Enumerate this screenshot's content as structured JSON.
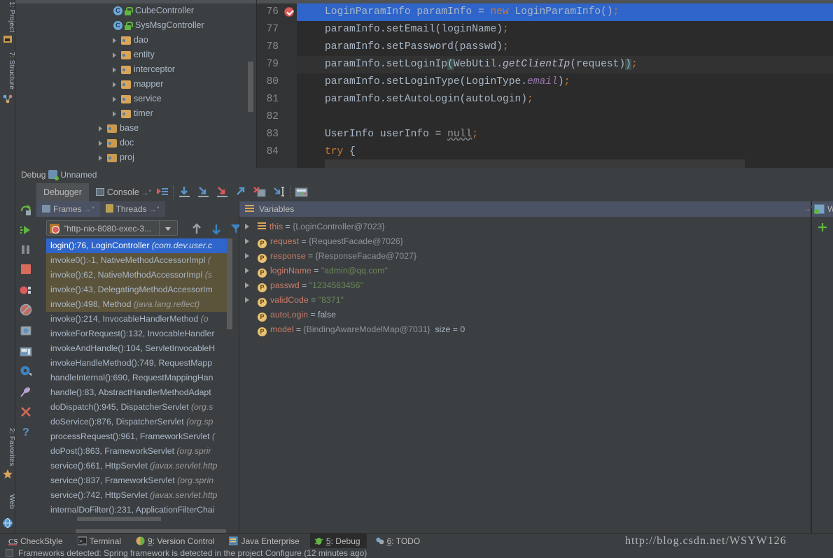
{
  "rail": {
    "tabs": [
      {
        "label": "1: Project",
        "icon": "project-icon",
        "selected": false
      },
      {
        "label": "7: Structure",
        "icon": "structure-icon",
        "selected": false
      },
      {
        "label": "2: Favorites",
        "icon": "star-icon",
        "selected": false
      },
      {
        "label": "Web",
        "icon": "web-icon",
        "selected": false
      }
    ]
  },
  "project_tree": {
    "rows": [
      {
        "label": "CubeController",
        "icon": "java-class-icon",
        "indent": 140,
        "arrow": false,
        "type": "class"
      },
      {
        "label": "SysMsgController",
        "icon": "java-class-icon",
        "indent": 140,
        "arrow": false,
        "type": "class"
      },
      {
        "label": "dao",
        "icon": "folder-icon",
        "indent": 118,
        "arrow": true,
        "type": "folder"
      },
      {
        "label": "entity",
        "icon": "folder-icon",
        "indent": 118,
        "arrow": true,
        "type": "folder"
      },
      {
        "label": "interceptor",
        "icon": "folder-icon",
        "indent": 118,
        "arrow": true,
        "type": "folder"
      },
      {
        "label": "mapper",
        "icon": "folder-icon",
        "indent": 118,
        "arrow": true,
        "type": "folder"
      },
      {
        "label": "service",
        "icon": "folder-icon",
        "indent": 118,
        "arrow": true,
        "type": "folder"
      },
      {
        "label": "timer",
        "icon": "folder-icon",
        "indent": 118,
        "arrow": true,
        "type": "folder"
      },
      {
        "label": "base",
        "icon": "folder-icon",
        "indent": 98,
        "arrow": true,
        "type": "folder"
      },
      {
        "label": "doc",
        "icon": "folder-icon",
        "indent": 98,
        "arrow": true,
        "type": "folder"
      },
      {
        "label": "proj",
        "icon": "folder-icon",
        "indent": 98,
        "arrow": true,
        "type": "folder"
      }
    ]
  },
  "editor": {
    "line_numbers": [
      "76",
      "77",
      "78",
      "79",
      "80",
      "81",
      "82",
      "83",
      "84"
    ],
    "breakpoint_line": "76",
    "lines": [
      {
        "n": "76",
        "state": "current"
      },
      {
        "n": "77",
        "state": "normal"
      },
      {
        "n": "78",
        "state": "normal"
      },
      {
        "n": "79",
        "state": "alt"
      },
      {
        "n": "80",
        "state": "normal"
      },
      {
        "n": "81",
        "state": "normal"
      },
      {
        "n": "82",
        "state": "normal"
      },
      {
        "n": "83",
        "state": "normal"
      },
      {
        "n": "84",
        "state": "normal"
      }
    ],
    "code_text": [
      "LoginParamInfo paramInfo = new LoginParamInfo();",
      "paramInfo.setEmail(loginName);",
      "paramInfo.setPassword(passwd);",
      "paramInfo.setLoginIp(WebUtil.getClientIp(request));",
      "paramInfo.setLoginType(LoginType.email);",
      "paramInfo.setAutoLogin(autoLogin);",
      "",
      "UserInfo userInfo = null;",
      "try {"
    ]
  },
  "debug_window": {
    "title": "Debug",
    "config_name": "Unnamed",
    "tabs": [
      {
        "label": "Debugger",
        "selected": true
      },
      {
        "label": "Console",
        "selected": false
      }
    ],
    "toolbar_icons": [
      "show-execution-point-icon",
      "step-over-icon",
      "step-into-icon",
      "force-step-into-icon",
      "step-out-icon",
      "drop-frame-icon",
      "run-to-cursor-icon",
      "evaluate-expression-icon"
    ],
    "action_icons": [
      "rerun-icon",
      "resume-program-icon",
      "pause-program-icon",
      "stop-icon",
      "view-breakpoints-icon",
      "mute-breakpoints-icon",
      "get-thread-dump-icon",
      "restore-layout-icon",
      "settings-icon",
      "pin-tab-icon",
      "close-icon",
      "help-icon"
    ]
  },
  "frames": {
    "tabs": [
      {
        "label": "Frames",
        "selected": true
      },
      {
        "label": "Threads",
        "selected": false
      }
    ],
    "thread_selector": "\"http-nio-8080-exec-3...",
    "nav_icons": [
      "arrow-up-icon",
      "arrow-down-icon",
      "filter-icon"
    ],
    "rows": [
      {
        "method": "login():76, LoginController",
        "pkg": "(com.dev.user.c",
        "style": "selected"
      },
      {
        "method": "invoke0():-1, NativeMethodAccessorImpl",
        "pkg": "(",
        "style": "lib"
      },
      {
        "method": "invoke():62, NativeMethodAccessorImpl",
        "pkg": "(s",
        "style": "lib"
      },
      {
        "method": "invoke():43, DelegatingMethodAccessorIm",
        "pkg": "",
        "style": "lib"
      },
      {
        "method": "invoke():498, Method",
        "pkg": "(java.lang.reflect)",
        "style": "lib"
      },
      {
        "method": "invoke():214, InvocableHandlerMethod",
        "pkg": "(o",
        "style": "normal"
      },
      {
        "method": "invokeForRequest():132, InvocableHandler",
        "pkg": "",
        "style": "normal"
      },
      {
        "method": "invokeAndHandle():104, ServletInvocableH",
        "pkg": "",
        "style": "normal"
      },
      {
        "method": "invokeHandleMethod():749, RequestMapp",
        "pkg": "",
        "style": "normal"
      },
      {
        "method": "handleInternal():690, RequestMappingHan",
        "pkg": "",
        "style": "normal"
      },
      {
        "method": "handle():83, AbstractHandlerMethodAdapt",
        "pkg": "",
        "style": "normal"
      },
      {
        "method": "doDispatch():945, DispatcherServlet",
        "pkg": "(org.s",
        "style": "normal"
      },
      {
        "method": "doService():876, DispatcherServlet",
        "pkg": "(org.sp",
        "style": "normal"
      },
      {
        "method": "processRequest():961, FrameworkServlet",
        "pkg": "(",
        "style": "normal"
      },
      {
        "method": "doPost():863, FrameworkServlet",
        "pkg": "(org.sprir",
        "style": "normal"
      },
      {
        "method": "service():661, HttpServlet",
        "pkg": "(javax.servlet.http",
        "style": "normal"
      },
      {
        "method": "service():837, FrameworkServlet",
        "pkg": "(org.sprin",
        "style": "normal"
      },
      {
        "method": "service():742, HttpServlet",
        "pkg": "(javax.servlet.http",
        "style": "normal"
      },
      {
        "method": "internalDoFilter():231, ApplicationFilterChai",
        "pkg": "",
        "style": "normal"
      }
    ]
  },
  "variables": {
    "header": "Variables",
    "rows": [
      {
        "expandable": true,
        "badge": "object",
        "name": "this",
        "value": "{LoginController@7023}",
        "value_kind": "ref",
        "extra": ""
      },
      {
        "expandable": true,
        "badge": "P",
        "name": "request",
        "value": "{RequestFacade@7026}",
        "value_kind": "ref",
        "extra": ""
      },
      {
        "expandable": true,
        "badge": "P",
        "name": "response",
        "value": "{ResponseFacade@7027}",
        "value_kind": "ref",
        "extra": ""
      },
      {
        "expandable": true,
        "badge": "P",
        "name": "loginName",
        "value": "\"admin@qq.com\"",
        "value_kind": "str",
        "extra": ""
      },
      {
        "expandable": true,
        "badge": "P",
        "name": "passwd",
        "value": "\"1234563456\"",
        "value_kind": "str",
        "extra": ""
      },
      {
        "expandable": true,
        "badge": "P",
        "name": "validCode",
        "value": "\"8371\"",
        "value_kind": "str",
        "extra": ""
      },
      {
        "expandable": false,
        "badge": "P",
        "name": "autoLogin",
        "value": "false",
        "value_kind": "num",
        "extra": ""
      },
      {
        "expandable": false,
        "badge": "P",
        "name": "model",
        "value": "{BindingAwareModelMap@7031}",
        "value_kind": "ref",
        "extra": "size = 0"
      }
    ]
  },
  "watches": {
    "header": "Watches",
    "add_label": "+",
    "remove_label": "−"
  },
  "statusbar": {
    "tabs": [
      {
        "label": "CheckStyle",
        "icon": "checkstyle-icon",
        "num": "",
        "selected": false
      },
      {
        "label": "Terminal",
        "icon": "terminal-icon",
        "num": "",
        "selected": false
      },
      {
        "label": ": Version Control",
        "icon": "version-control-icon",
        "num": "9",
        "selected": false
      },
      {
        "label": "Java Enterprise",
        "icon": "java-enterprise-icon",
        "num": "",
        "selected": false
      },
      {
        "label": ": Debug",
        "icon": "debug-icon",
        "num": "5",
        "selected": true
      },
      {
        "label": ": TODO",
        "icon": "todo-icon",
        "num": "6",
        "selected": false
      }
    ]
  },
  "bottom_message": "Frameworks detected: Spring framework is detected in the project Configure (12 minutes ago)",
  "watermark": "http://blog.csdn.net/WSYW126",
  "watermark_num": "79",
  "colors": {
    "bg": "#3c3f41",
    "editor_bg": "#2b2b2b",
    "selection": "#2f65ca",
    "accent_orange": "#cc7832",
    "string_green": "#6a8759",
    "var_name": "#c77b6b",
    "lib_frame": "#5b533a"
  }
}
